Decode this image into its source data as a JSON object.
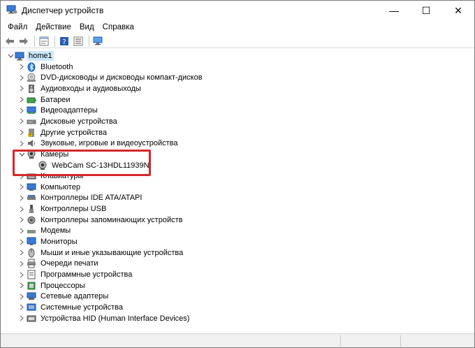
{
  "window": {
    "title": "Диспетчер устройств",
    "controls": {
      "minimize": "—",
      "maximize": "☐",
      "close": "✕"
    }
  },
  "menu": [
    "Файл",
    "Действие",
    "Вид",
    "Справка"
  ],
  "toolbar": {
    "buttons": [
      "back-arrow-icon",
      "forward-arrow-icon",
      "properties-icon",
      "help-icon",
      "view-icon",
      "monitor-scan-icon"
    ]
  },
  "tree": {
    "root": {
      "label": "home1",
      "icon": "computer-icon"
    },
    "categories": [
      {
        "label": "Bluetooth",
        "icon": "bluetooth-icon",
        "expanded": false
      },
      {
        "label": "DVD-дисководы и дисководы компакт-дисков",
        "icon": "dvd-drive-icon",
        "expanded": false
      },
      {
        "label": "Аудиовходы и аудиовыходы",
        "icon": "speaker-icon",
        "expanded": false
      },
      {
        "label": "Батареи",
        "icon": "battery-icon",
        "expanded": false
      },
      {
        "label": "Видеоадаптеры",
        "icon": "display-adapter-icon",
        "expanded": false
      },
      {
        "label": "Дисковые устройства",
        "icon": "disk-drive-icon",
        "expanded": false
      },
      {
        "label": "Другие устройства",
        "icon": "unknown-device-icon",
        "expanded": false
      },
      {
        "label": "Звуковые, игровые и видеоустройства",
        "icon": "sound-icon",
        "expanded": false
      },
      {
        "label": "Камеры",
        "icon": "camera-icon",
        "expanded": true,
        "children": [
          {
            "label": "WebCam SC-13HDL11939N",
            "icon": "webcam-icon"
          }
        ]
      },
      {
        "label": "Клавиатуры",
        "icon": "keyboard-icon",
        "expanded": false
      },
      {
        "label": "Компьютер",
        "icon": "computer-small-icon",
        "expanded": false
      },
      {
        "label": "Контроллеры IDE ATA/ATAPI",
        "icon": "ide-controller-icon",
        "expanded": false
      },
      {
        "label": "Контроллеры USB",
        "icon": "usb-icon",
        "expanded": false
      },
      {
        "label": "Контроллеры запоминающих устройств",
        "icon": "storage-controller-icon",
        "expanded": false
      },
      {
        "label": "Модемы",
        "icon": "modem-icon",
        "expanded": false
      },
      {
        "label": "Мониторы",
        "icon": "monitor-icon",
        "expanded": false
      },
      {
        "label": "Мыши и иные указывающие устройства",
        "icon": "mouse-icon",
        "expanded": false
      },
      {
        "label": "Очереди печати",
        "icon": "printer-icon",
        "expanded": false
      },
      {
        "label": "Программные устройства",
        "icon": "software-device-icon",
        "expanded": false
      },
      {
        "label": "Процессоры",
        "icon": "processor-icon",
        "expanded": false
      },
      {
        "label": "Сетевые адаптеры",
        "icon": "network-adapter-icon",
        "expanded": false
      },
      {
        "label": "Системные устройства",
        "icon": "system-device-icon",
        "expanded": false
      },
      {
        "label": "Устройства HID (Human Interface Devices)",
        "icon": "hid-icon",
        "expanded": false
      }
    ]
  },
  "colors": {
    "highlight": "#d7262d",
    "selection": "#cce8ff",
    "accent": "#1a73e8"
  }
}
